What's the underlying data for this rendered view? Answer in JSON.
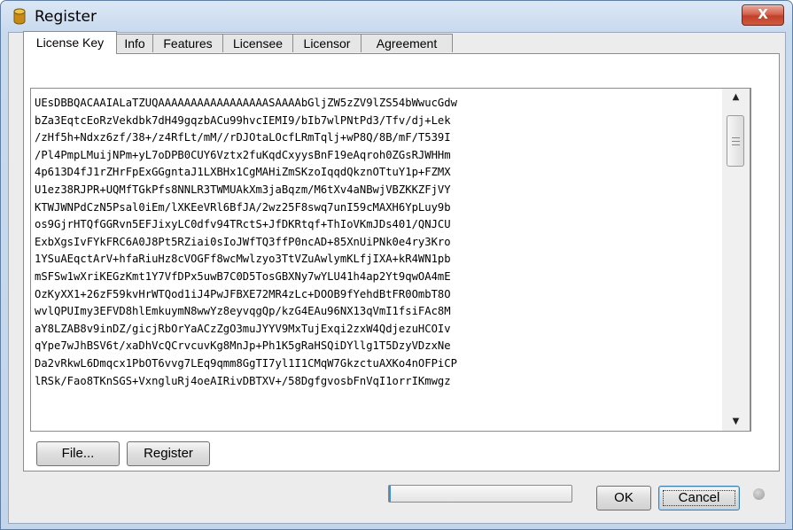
{
  "window": {
    "title": "Register",
    "close_label": "X"
  },
  "tabs": [
    {
      "label": "License Key",
      "active": true
    },
    {
      "label": "Info",
      "active": false
    },
    {
      "label": "Features",
      "active": false
    },
    {
      "label": "Licensee",
      "active": false
    },
    {
      "label": "Licensor",
      "active": false
    },
    {
      "label": "Agreement",
      "active": false
    }
  ],
  "license_text": {
    "lines": [
      "UEsDBBQACAAIALaTZUQAAAAAAAAAAAAAAAAASAAAAbGljZW5zZV9lZS54bWwucGdw",
      "bZa3EqtcEoRzVekdbk7dH49gqzbACu99hvcIEMI9/bIb7wlPNtPd3/Tfv/dj+Lek",
      "/zHf5h+Ndxz6zf/38+/z4RfLt/mM//rDJOtaLOcfLRmTqlj+wP8Q/8B/mF/T539I",
      "/Pl4PmpLMuijNPm+yL7oDPB0CUY6Vztx2fuKqdCxyysBnF19eAqroh0ZGsRJWHHm",
      "4p613D4fJ1rZHrFpExGGgntaJ1LXBHx1CgMAHiZmSKzoIqqdQkznOTtuY1p+FZMX",
      "U1ez38RJPR+UQMfTGkPfs8NNLR3TWMUAkXm3jaBqzm/M6tXv4aNBwjVBZKKZFjVY",
      "KTWJWNPdCzN5Psal0iEm/lXKEeVRl6BfJA/2wz25F8swq7unI59cMAXH6YpLuy9b",
      "os9GjrHTQfGGRvn5EFJixyLC0dfv94TRctS+JfDKRtqf+ThIoVKmJDs401/QNJCU",
      "ExbXgsIvFYkFRC6A0J8Pt5RZiai0sIoJWfTQ3ffP0ncAD+85XnUiPNk0e4ry3Kro",
      "1YSuAEqctArV+hfaRiuHz8cVOGFf8wcMwlzyo3TtVZuAwlymKLfjIXA+kR4WN1pb",
      "mSFSw1wXriKEGzKmt1Y7VfDPx5uwB7C0D5TosGBXNy7wYLU41h4ap2Yt9qwOA4mE",
      "OzKyXX1+26zF59kvHrWTQod1iJ4PwJFBXE72MR4zLc+DOOB9fYehdBtFR0OmbT8O",
      "wvlQPUImy3EFVD8hlEmkuymN8wwYz8eyvqgQp/kzG4EAu96NX13qVmI1fsiFAc8M",
      "aY8LZAB8v9inDZ/gicjRbOrYaACzZgO3muJYYV9MxTujExqi2zxW4QdjezuHCOIv",
      "qYpe7wJhBSV6t/xaDhVcQCrvcuvKg8MnJp+Ph1K5gRaHSQiDYllg1T5DzyVDzxNe",
      "Da2vRkwL6Dmqcx1PbOT6vvg7LEq9qmm8GgTI7yl1I1CMqW7GkzctuAXKo4nOFPiCP",
      "lRSk/Fao8TKnSGS+VxngluRj4oeAIRivDBTXV+/58DgfgvosbFnVqI1orrIKmwgz"
    ]
  },
  "buttons": {
    "file": "File...",
    "register": "Register",
    "ok": "OK",
    "cancel": "Cancel"
  },
  "progress": {
    "value": 0.01
  },
  "colors": {
    "progress_fill": "#3d8ee0",
    "close_button": "#c2402a"
  },
  "icons": {
    "title": "database-icon",
    "scroll_up": "triangle-up",
    "scroll_down": "triangle-down"
  }
}
